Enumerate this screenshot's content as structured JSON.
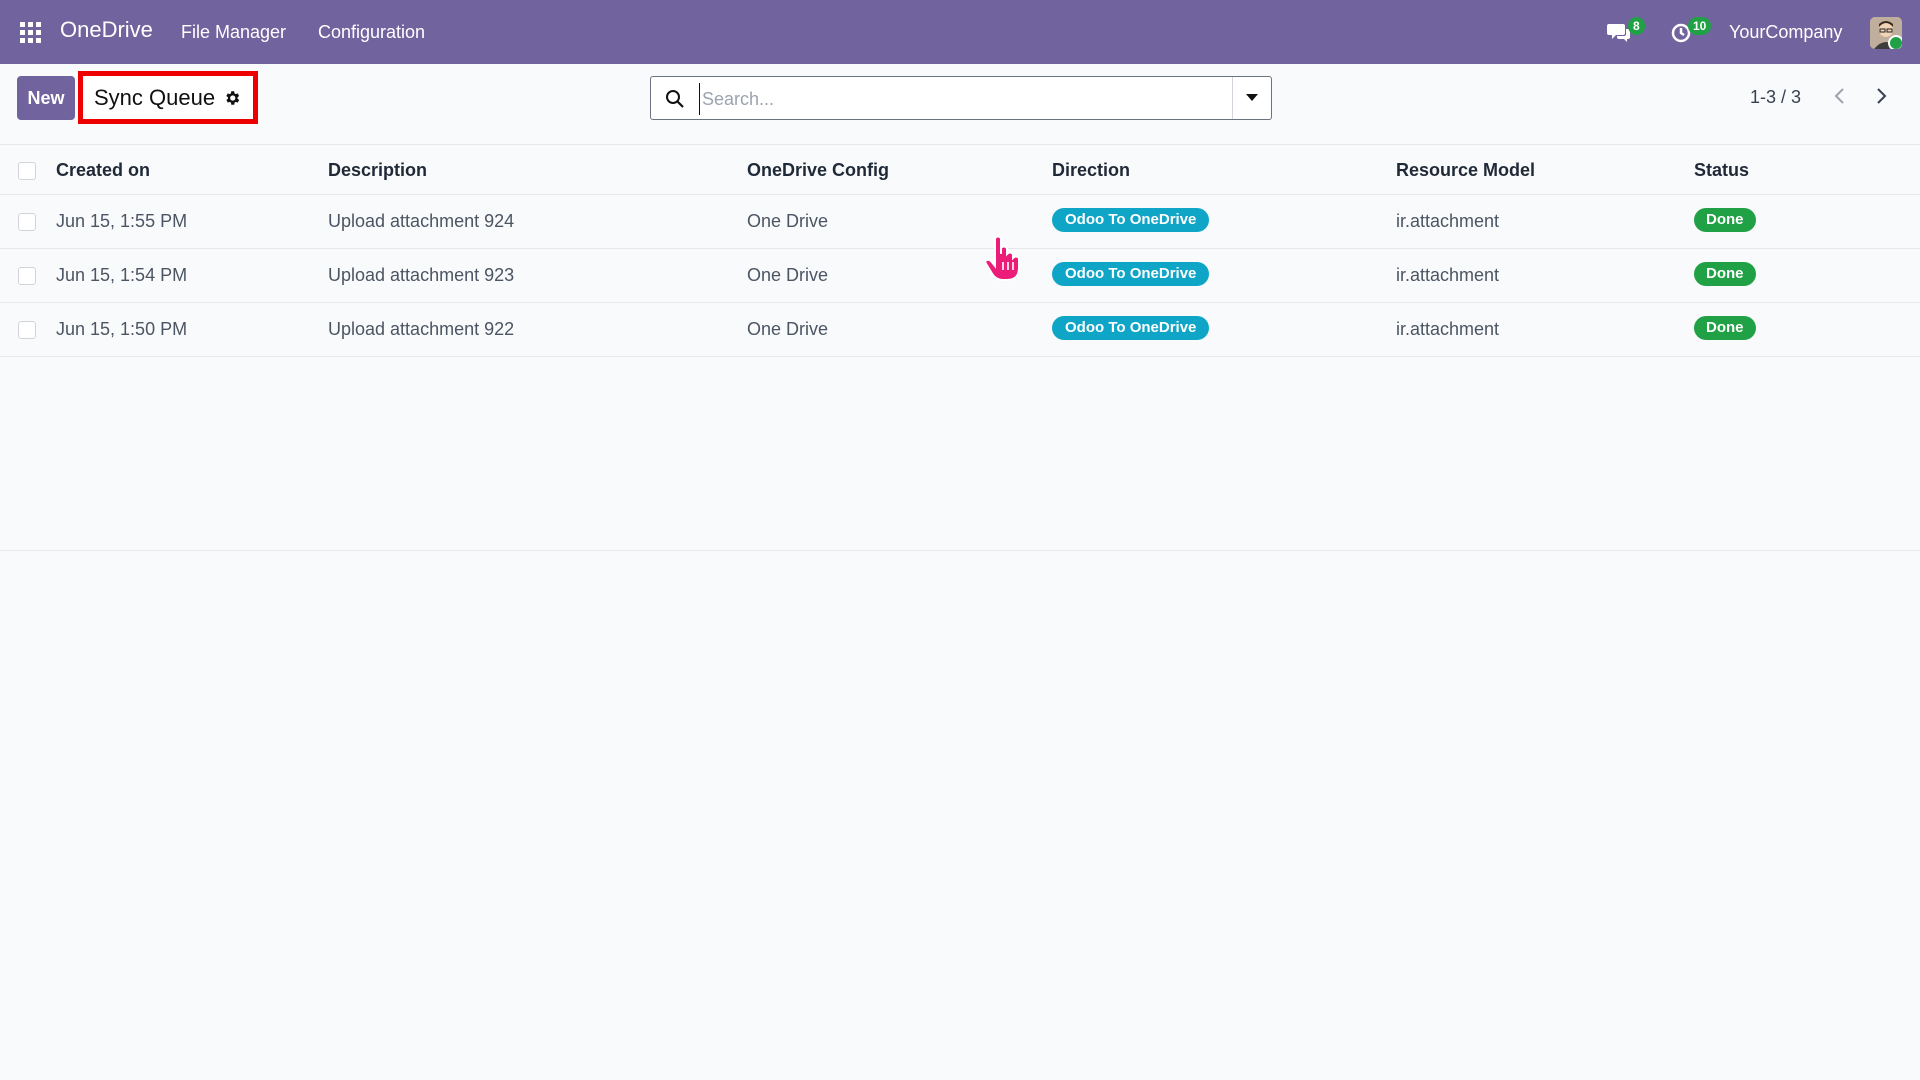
{
  "navbar": {
    "brand": "OneDrive",
    "menu": [
      "File Manager",
      "Configuration"
    ],
    "messages_count": "8",
    "activities_count": "10",
    "company": "YourCompany"
  },
  "control_panel": {
    "new_label": "New",
    "title": "Sync Queue",
    "search_placeholder": "Search...",
    "pager": "1-3 / 3"
  },
  "table": {
    "columns": [
      "Created on",
      "Description",
      "OneDrive Config",
      "Direction",
      "Resource Model",
      "Status"
    ],
    "rows": [
      {
        "created_on": "Jun 15, 1:55 PM",
        "description": "Upload attachment 924",
        "config": "One Drive",
        "direction": "Odoo To OneDrive",
        "model": "ir.attachment",
        "status": "Done"
      },
      {
        "created_on": "Jun 15, 1:54 PM",
        "description": "Upload attachment 923",
        "config": "One Drive",
        "direction": "Odoo To OneDrive",
        "model": "ir.attachment",
        "status": "Done"
      },
      {
        "created_on": "Jun 15, 1:50 PM",
        "description": "Upload attachment 922",
        "config": "One Drive",
        "direction": "Odoo To OneDrive",
        "model": "ir.attachment",
        "status": "Done"
      }
    ]
  },
  "colors": {
    "navbar": "#71639e",
    "direction_pill": "#0ea5c6",
    "status_done": "#21a146",
    "highlight_border": "#e00000"
  }
}
